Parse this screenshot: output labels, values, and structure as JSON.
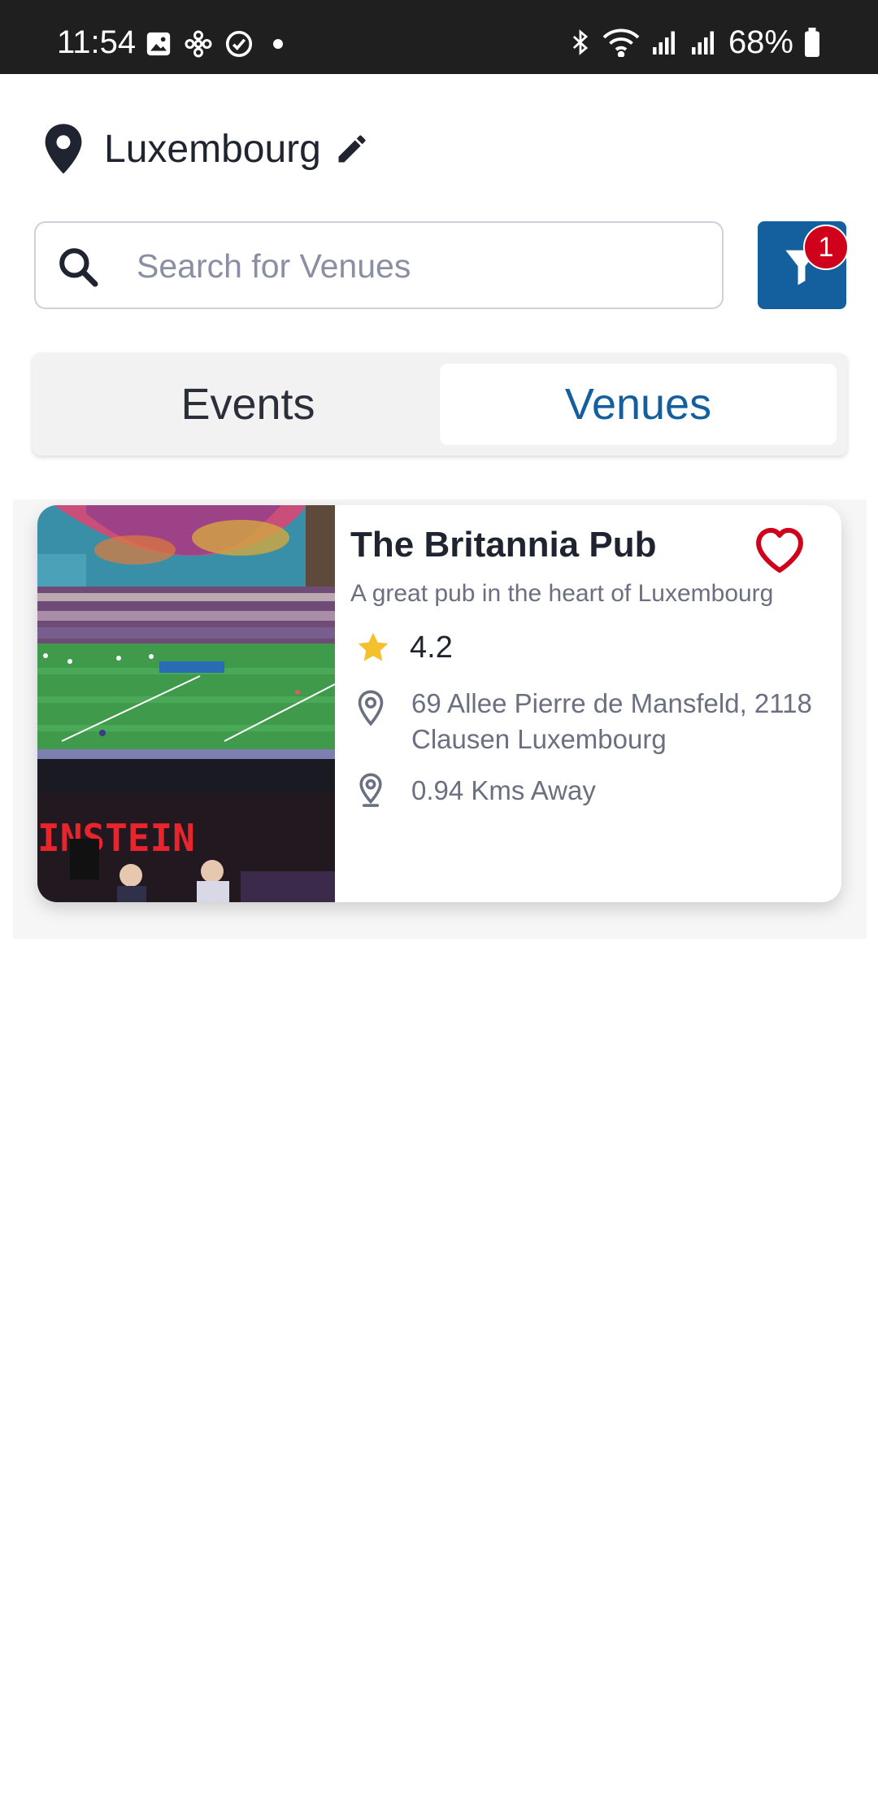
{
  "status_bar": {
    "time": "11:54",
    "battery": "68%"
  },
  "location": {
    "city": "Luxembourg"
  },
  "search": {
    "placeholder": "Search for Venues",
    "value": ""
  },
  "filter": {
    "badge_count": "1"
  },
  "tabs": [
    {
      "label": "Events",
      "selected": false
    },
    {
      "label": "Venues",
      "selected": true
    }
  ],
  "venues": [
    {
      "name": "The Britannia Pub",
      "description": "A great pub in the heart of Luxembourg",
      "rating": "4.2",
      "address": "69 Allee Pierre de Mansfeld, 2118 Clausen Luxembourg",
      "distance": "0.94 Kms Away",
      "favorite": false
    }
  ],
  "colors": {
    "primary": "#145f9e",
    "badge": "#d0021b",
    "heart": "#d0021b",
    "star": "#f5c02e",
    "text_dark": "#1f2430",
    "text_muted": "#6b7080"
  },
  "icons": [
    "image-icon",
    "flower-icon",
    "check-circle-icon",
    "bluetooth-icon",
    "wifi-icon",
    "signal-icon",
    "battery-icon",
    "location-pin-icon",
    "edit-pencil-icon",
    "search-icon",
    "filter-icon",
    "heart-icon",
    "star-icon",
    "map-pin-icon",
    "distance-pin-icon"
  ]
}
